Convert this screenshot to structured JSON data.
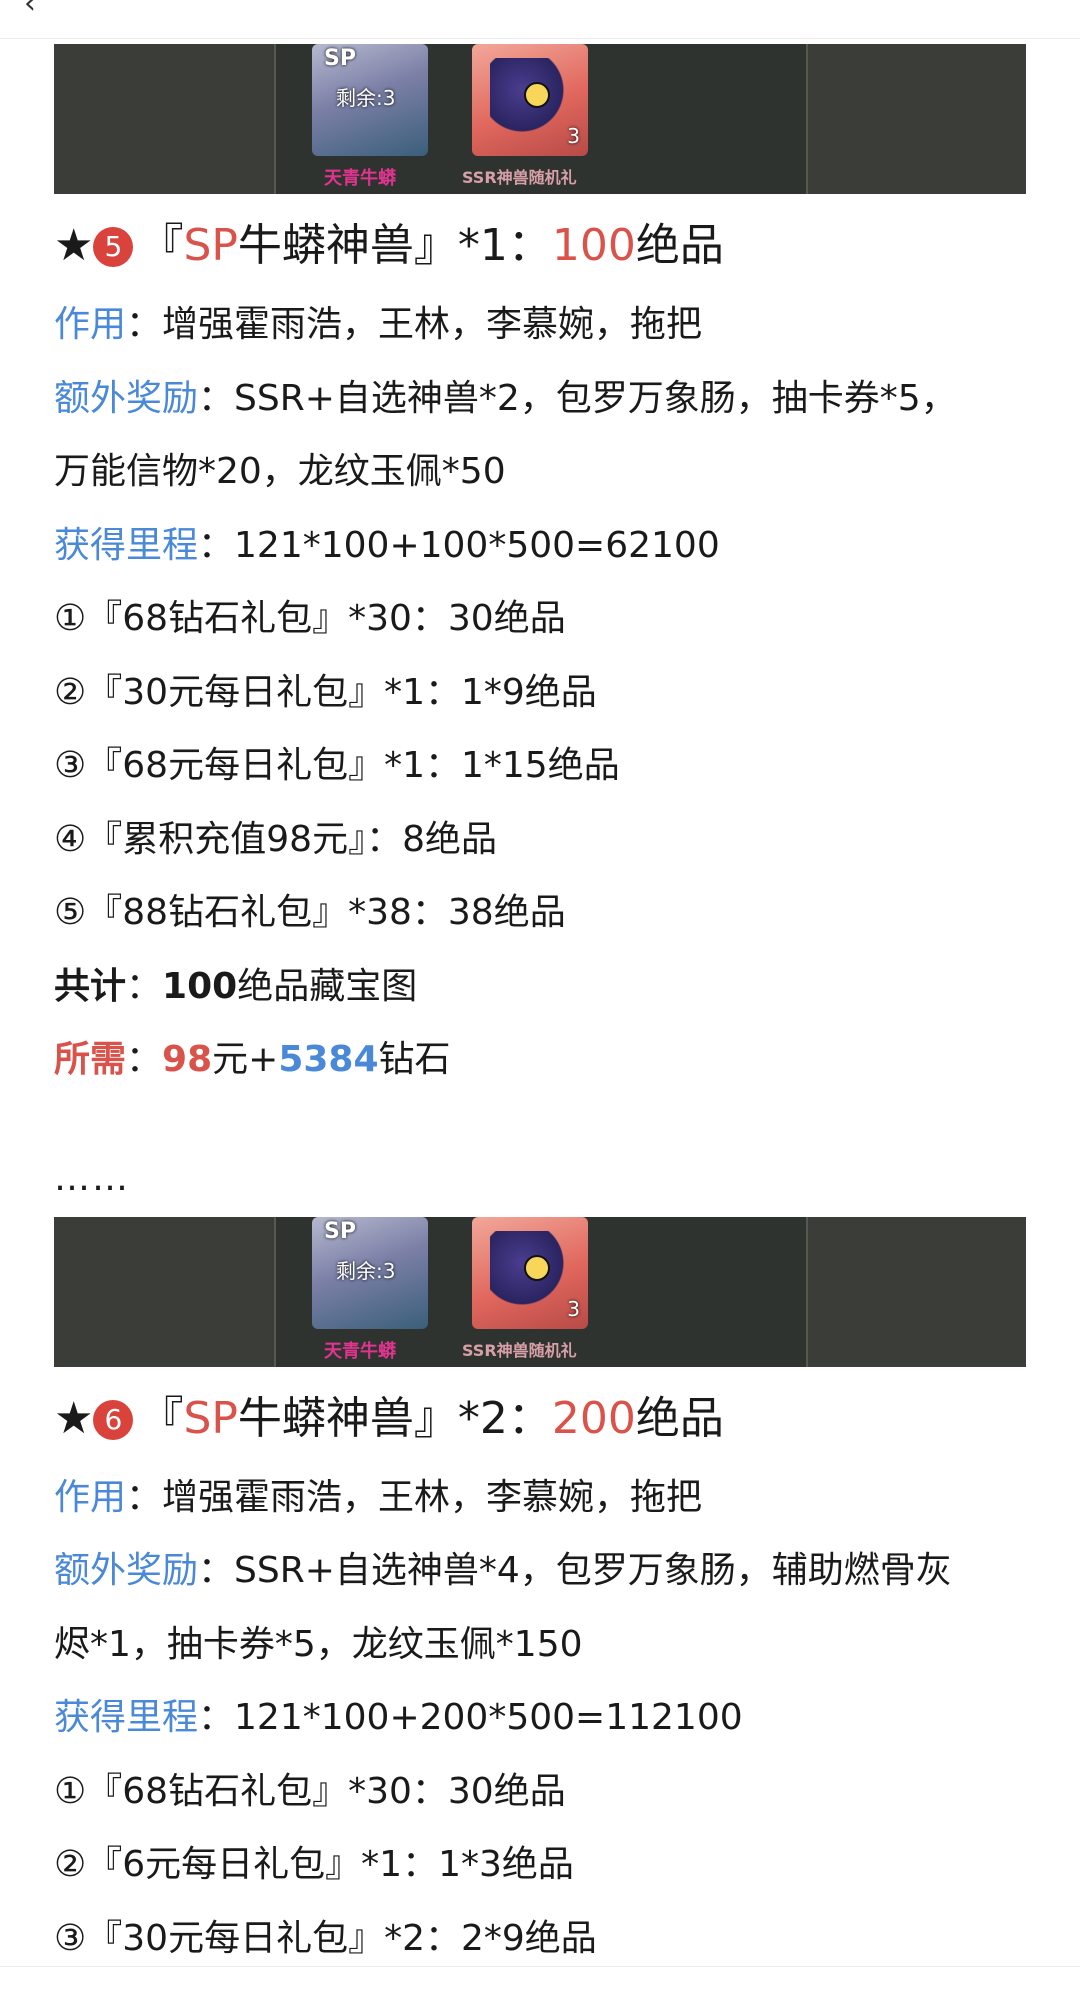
{
  "header": {
    "back_glyph": "‹"
  },
  "banner": {
    "left_card": {
      "sp_label": "SP",
      "remain_label": "剩余:3",
      "caption": "天青牛蟒"
    },
    "right_card": {
      "count": "3",
      "caption": "SSR神兽随机礼"
    }
  },
  "section5": {
    "star": "★",
    "num": "5",
    "title_open": "『",
    "title_sp": "SP",
    "title_name": "牛蟒神兽』*1：",
    "title_amount": "100",
    "title_unit": "绝品",
    "effect_label": "作用",
    "effect_text": "：增强霍雨浩，王林，李慕婉，拖把",
    "bonus_label": "额外奖励",
    "bonus_text": "：SSR+自选神兽*2，包罗万象肠，抽卡券*5，",
    "bonus_text2": "万能信物*20，龙纹玉佩*50",
    "mileage_label": "获得里程",
    "mileage_text": "：121*100+100*500=62100",
    "items": [
      "①『68钻石礼包』*30：30绝品",
      "②『30元每日礼包』*1：1*9绝品",
      "③『68元每日礼包』*1：1*15绝品",
      "④『累积充值98元』：8绝品",
      "⑤『88钻石礼包』*38：38绝品"
    ],
    "total_label": "共计",
    "total_sep": "：",
    "total_amount": "100",
    "total_unit": "绝品藏宝图",
    "need_label": "所需",
    "need_sep": "：",
    "need_yuan": "98",
    "need_yuan_unit": "元+",
    "need_diamond": "5384",
    "need_diamond_unit": "钻石"
  },
  "ellipsis": "……",
  "section6": {
    "star": "★",
    "num": "6",
    "title_open": "『",
    "title_sp": "SP",
    "title_name": "牛蟒神兽』*2：",
    "title_amount": "200",
    "title_unit": "绝品",
    "effect_label": "作用",
    "effect_text": "：增强霍雨浩，王林，李慕婉，拖把",
    "bonus_label": "额外奖励",
    "bonus_text": "：SSR+自选神兽*4，包罗万象肠，辅助燃骨灰",
    "bonus_text2": "烬*1，抽卡券*5，龙纹玉佩*150",
    "mileage_label": "获得里程",
    "mileage_text": "：121*100+200*500=112100",
    "items": [
      "①『68钻石礼包』*30：30绝品",
      "②『6元每日礼包』*1：1*3绝品",
      "③『30元每日礼包』*2：2*9绝品"
    ]
  },
  "colors": {
    "red": "#d9534b",
    "blue": "#4a88d8",
    "badge": "#d9433b"
  }
}
